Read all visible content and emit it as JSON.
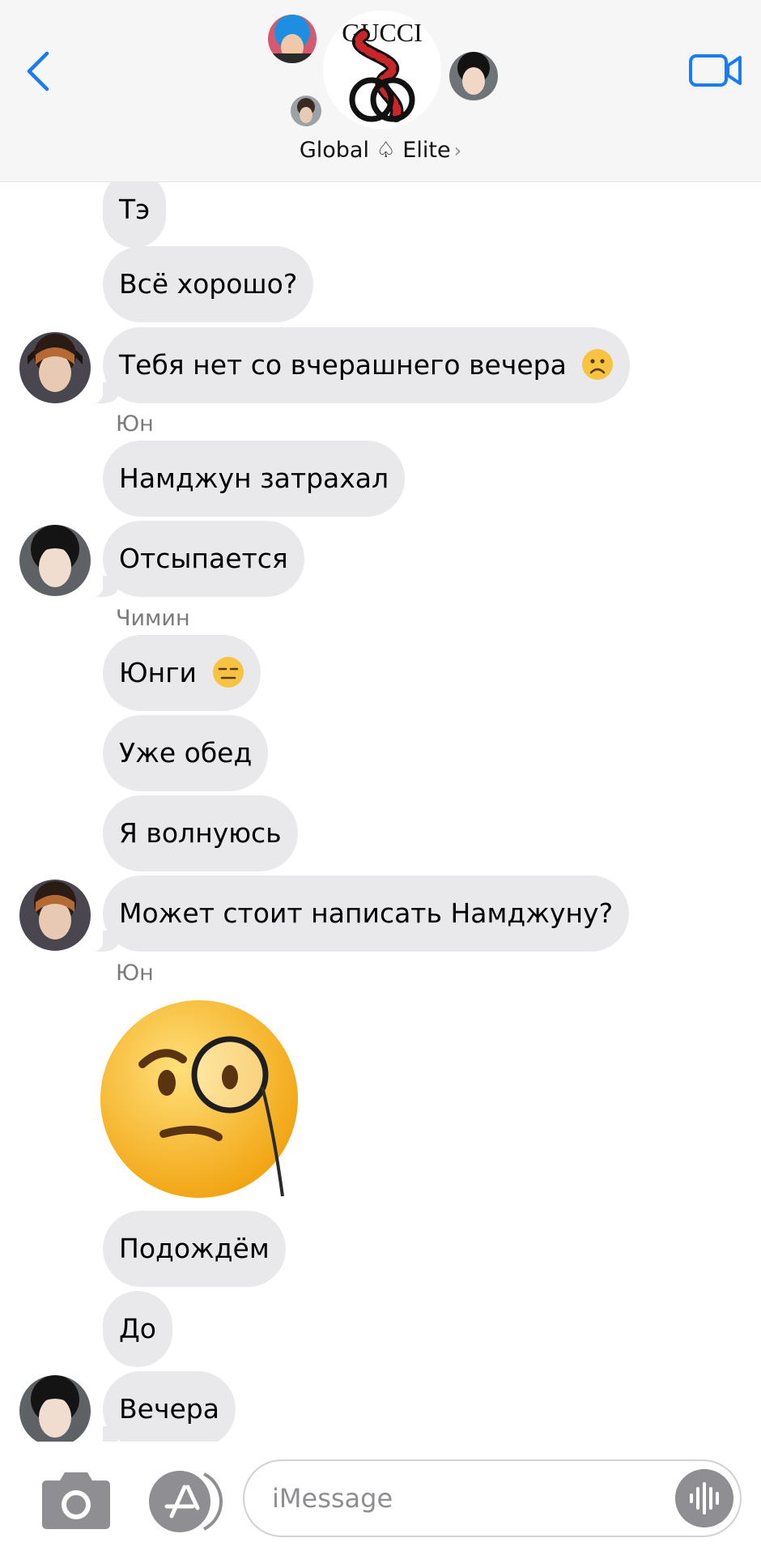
{
  "header": {
    "group_name": "Global ♤ Elite",
    "chevron": "›",
    "logo_text": "GUCCI",
    "icons": {
      "back": "chevron-left-icon",
      "video": "video-camera-icon"
    },
    "accent_color": "#1a7cf2"
  },
  "messages": [
    {
      "sender": "",
      "text": "Тэ"
    },
    {
      "sender": "",
      "text": "Всё хорошо?"
    },
    {
      "sender": "",
      "text": "Тебя нет со вчерашнего вечера",
      "emoji": "frowning-face"
    },
    {
      "sender": "Юн",
      "text": "Намджун затрахал"
    },
    {
      "sender": "",
      "text": "Отсыпается"
    },
    {
      "sender": "Чимин",
      "text": "Юнги",
      "emoji": "expressionless-face"
    },
    {
      "sender": "",
      "text": "Уже обед"
    },
    {
      "sender": "",
      "text": "Я волнуюсь"
    },
    {
      "sender": "",
      "text": "Может стоит написать Намджуну?"
    },
    {
      "sender": "Юн",
      "emoji_only": "face-with-monocle"
    },
    {
      "sender": "",
      "text": "Подождём"
    },
    {
      "sender": "",
      "text": "До"
    },
    {
      "sender": "",
      "text": "Вечера"
    }
  ],
  "composer": {
    "placeholder": "iMessage",
    "icons": {
      "camera": "camera-icon",
      "apps": "app-store-icon",
      "voice": "waveform-icon"
    }
  },
  "colors": {
    "bubble_gray": "#e9e9eb",
    "sender_gray": "#7a7a7f"
  }
}
